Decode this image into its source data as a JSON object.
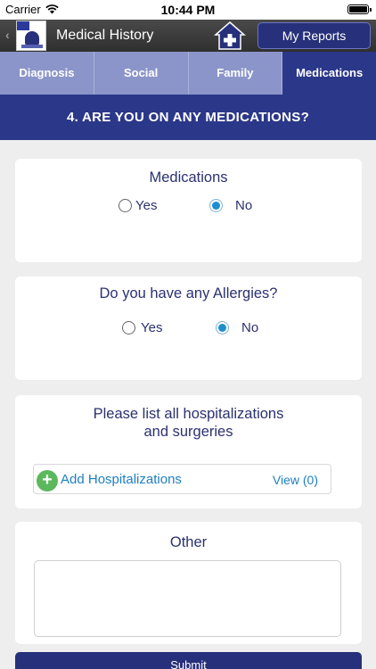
{
  "status_bar": {
    "carrier": "Carrier",
    "time": "10:44 PM"
  },
  "nav": {
    "title": "Medical History",
    "my_reports_label": "My Reports"
  },
  "tabs": [
    {
      "label": "Diagnosis",
      "active": false
    },
    {
      "label": "Social",
      "active": false
    },
    {
      "label": "Family",
      "active": false
    },
    {
      "label": "Medications",
      "active": true
    }
  ],
  "section": {
    "title": "4. ARE YOU ON ANY MEDICATIONS?"
  },
  "medications": {
    "title": "Medications",
    "yes_label": "Yes",
    "no_label": "No",
    "selected": "No"
  },
  "allergies": {
    "title": "Do you have any Allergies?",
    "yes_label": "Yes",
    "no_label": "No",
    "selected": "No"
  },
  "hospitalizations": {
    "title_line1": "Please list all hospitalizations",
    "title_line2": "and surgeries",
    "add_label": "Add Hospitalizations",
    "view_label": "View (0)"
  },
  "other": {
    "title": "Other",
    "value": ""
  },
  "submit_label": "Submit",
  "colors": {
    "primary": "#2b3789",
    "tab_inactive": "#8c95c9",
    "link": "#1d7fc0",
    "add_icon": "#5bb85c"
  }
}
